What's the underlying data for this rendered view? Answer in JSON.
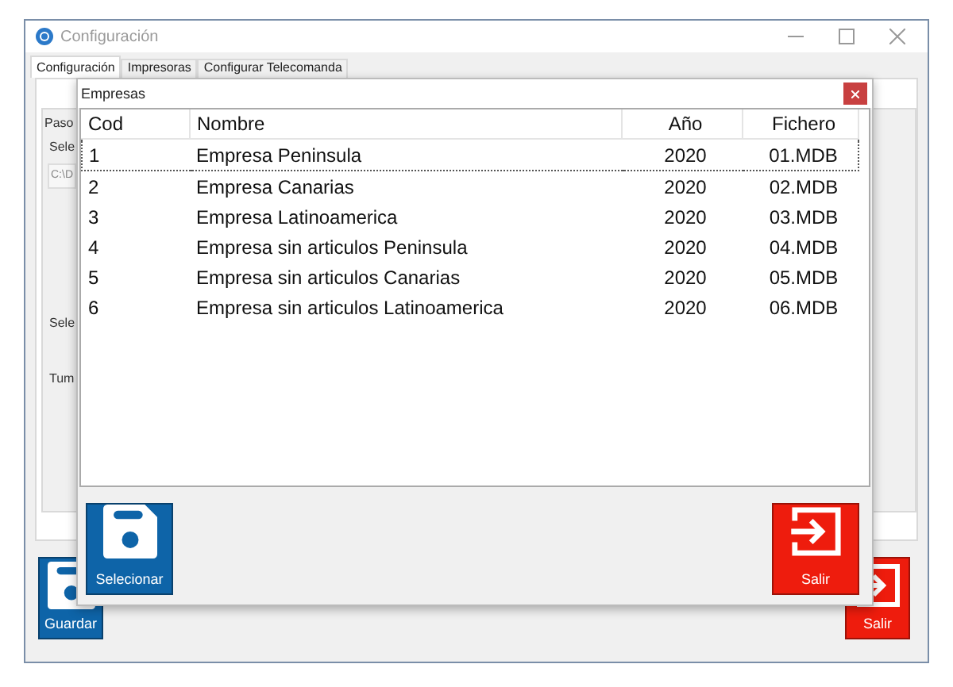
{
  "window": {
    "title": "Configuración"
  },
  "tabs": [
    {
      "label": "Configuración",
      "selected": true
    },
    {
      "label": "Impresoras",
      "selected": false
    },
    {
      "label": "Configurar Telecomanda",
      "selected": false
    }
  ],
  "page": {
    "group_label": "Paso",
    "labels": [
      "Sele",
      "Sele",
      "Tum"
    ],
    "path_value": "C:\\D"
  },
  "buttons": [
    {
      "label": "Guardar",
      "kind": "save"
    },
    {
      "label": "Salir",
      "kind": "exit"
    }
  ],
  "dialog": {
    "title": "Empresas",
    "table": {
      "columns": [
        "Cod",
        "Nombre",
        "Año",
        "Fichero"
      ],
      "rows": [
        {
          "cells": [
            "1",
            "Empresa Peninsula",
            "2020",
            "01.MDB"
          ],
          "selected": true
        },
        {
          "cells": [
            "2",
            "Empresa Canarias",
            "2020",
            "02.MDB"
          ],
          "selected": false
        },
        {
          "cells": [
            "3",
            "Empresa Latinoamerica",
            "2020",
            "03.MDB"
          ],
          "selected": false
        },
        {
          "cells": [
            "4",
            "Empresa sin articulos Peninsula",
            "2020",
            "04.MDB"
          ],
          "selected": false
        },
        {
          "cells": [
            "5",
            "Empresa sin articulos Canarias",
            "2020",
            "05.MDB"
          ],
          "selected": false
        },
        {
          "cells": [
            "6",
            "Empresa sin articulos Latinoamerica",
            "2020",
            "06.MDB"
          ],
          "selected": false
        }
      ]
    },
    "buttons": [
      {
        "label": "Selecionar",
        "kind": "save"
      },
      {
        "label": "Salir",
        "kind": "exit"
      }
    ]
  }
}
